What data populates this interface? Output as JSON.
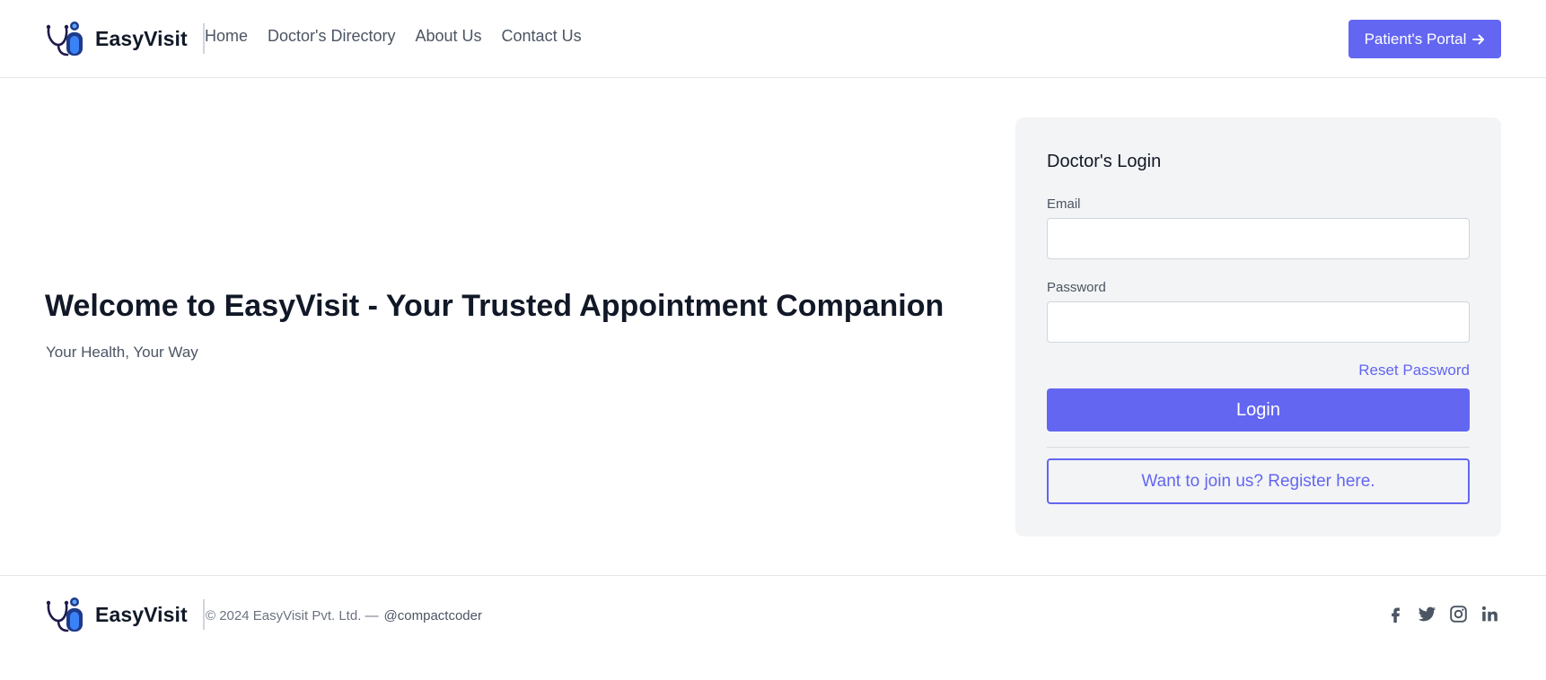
{
  "brand": {
    "name": "EasyVisit",
    "logo_icon": "stethoscope-logo-icon"
  },
  "nav": {
    "items": [
      "Home",
      "Doctor's Directory",
      "About Us",
      "Contact Us"
    ]
  },
  "header": {
    "portal_label": "Patient's Portal",
    "portal_icon": "arrow-right-icon"
  },
  "hero": {
    "title": "Welcome to EasyVisit - Your Trusted Appointment Companion",
    "subtitle": "Your Health, Your Way"
  },
  "login": {
    "title": "Doctor's Login",
    "email_label": "Email",
    "email_value": "",
    "password_label": "Password",
    "password_value": "",
    "reset_label": "Reset Password",
    "login_label": "Login",
    "register_label": "Want to join us? Register here."
  },
  "footer": {
    "copyright": "© 2024 EasyVisit Pvt. Ltd. —",
    "handle": "@compactcoder",
    "socials": [
      "facebook-icon",
      "twitter-icon",
      "instagram-icon",
      "linkedin-icon"
    ]
  },
  "colors": {
    "accent": "#6366f1",
    "text": "#111827",
    "muted": "#4b5563",
    "card_bg": "#f3f4f6"
  }
}
